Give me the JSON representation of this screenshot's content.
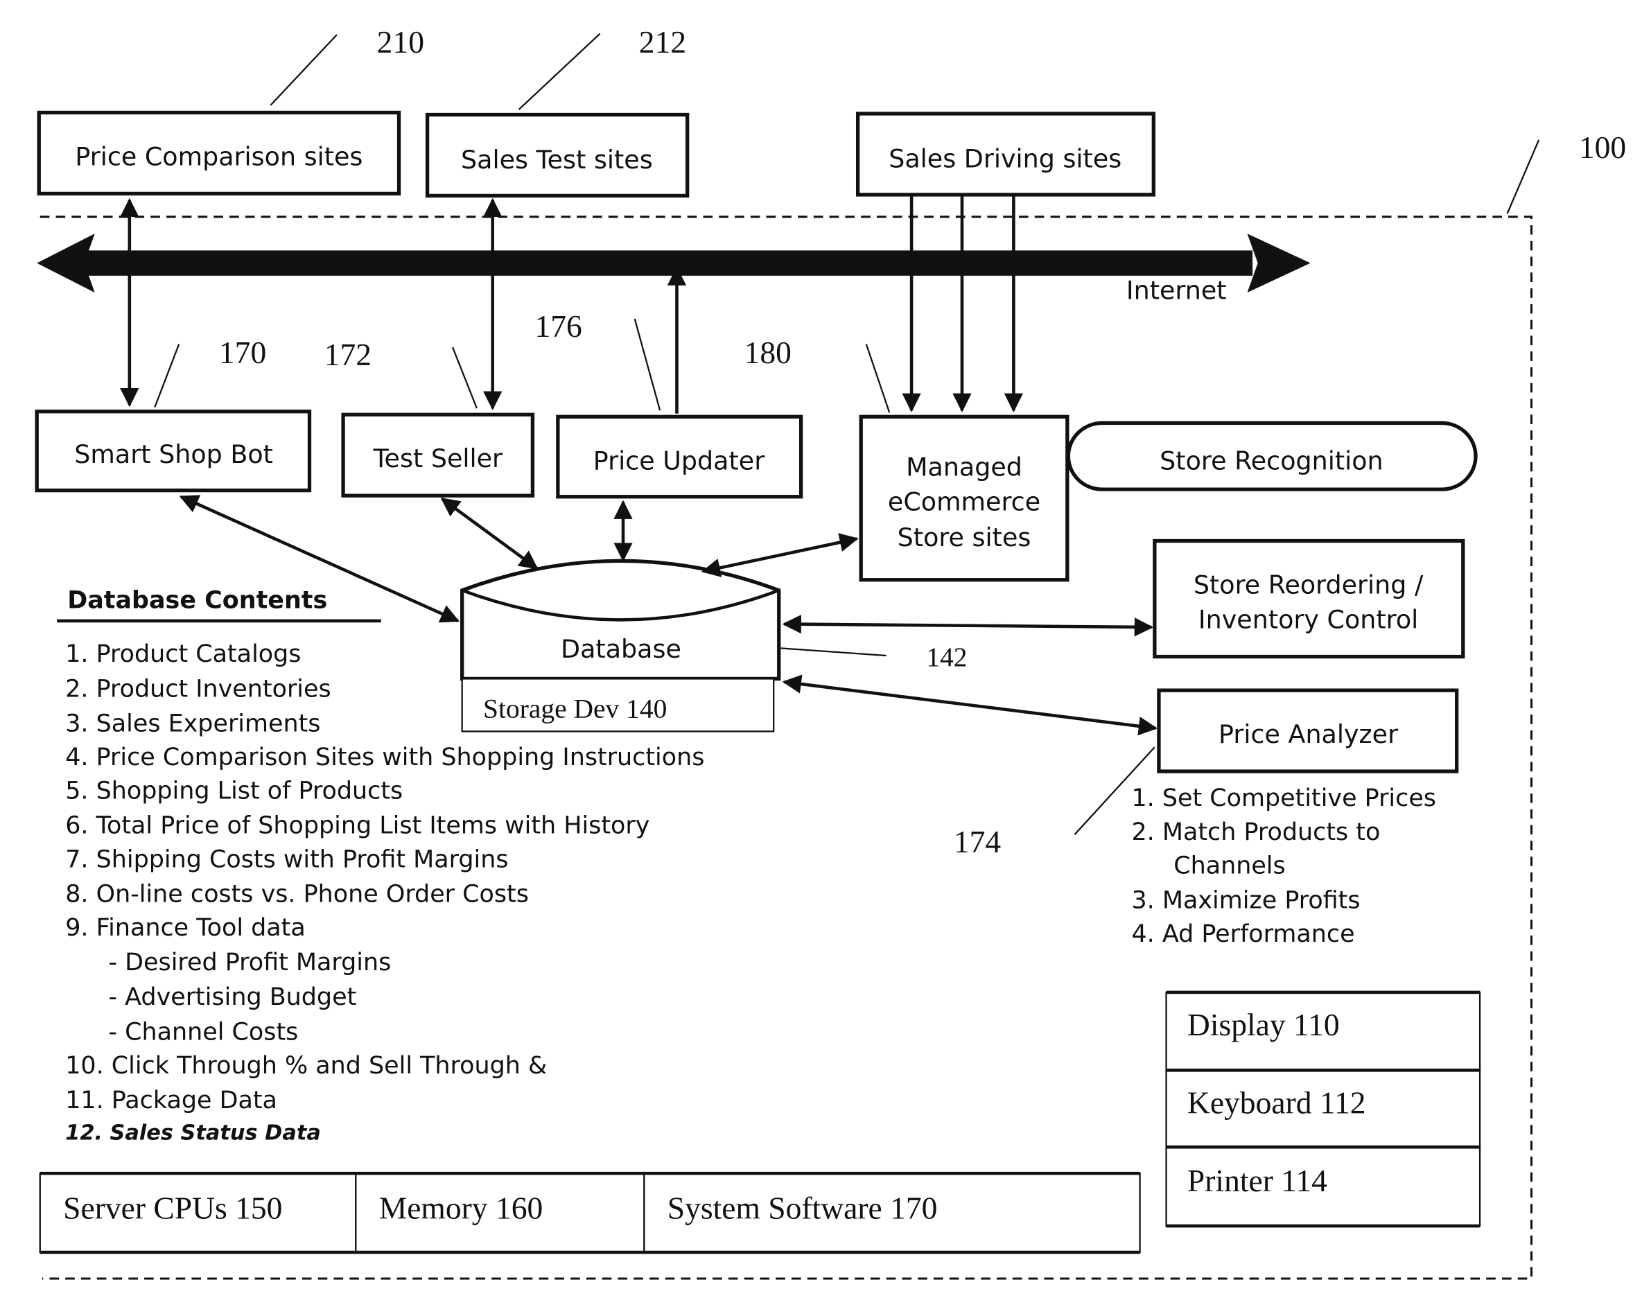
{
  "figure_ref": "100",
  "external_sites": [
    {
      "label": "Price Comparison sites",
      "ref": "210"
    },
    {
      "label": "Sales Test sites",
      "ref": "212"
    },
    {
      "label": "Sales Driving sites"
    }
  ],
  "internet_label": "Internet",
  "modules": {
    "smart_shop_bot": {
      "label": "Smart Shop Bot",
      "ref": "170"
    },
    "test_seller": {
      "label": "Test Seller",
      "ref": "172"
    },
    "price_updater": {
      "label": "Price Updater",
      "ref": "176"
    },
    "managed_store": {
      "lines": [
        "Managed",
        "eCommerce",
        "Store sites"
      ],
      "ref": "180"
    },
    "store_recognition": {
      "label": "Store Recognition"
    },
    "store_reordering": {
      "lines": [
        "Store Reordering /",
        "Inventory Control"
      ]
    },
    "price_analyzer": {
      "label": "Price Analyzer",
      "ref": "174"
    }
  },
  "database": {
    "label": "Database",
    "storage_label": "Storage Dev 140",
    "ref": "142"
  },
  "database_contents": {
    "title": "Database Contents",
    "items": [
      "1.  Product Catalogs",
      "2.  Product Inventories",
      "3.  Sales Experiments",
      "4.  Price Comparison Sites with Shopping Instructions",
      "5.  Shopping List of Products",
      "6.  Total Price of Shopping List Items with History",
      "7.  Shipping Costs with Profit Margins",
      "8.  On-line costs vs. Phone Order Costs",
      "9.  Finance Tool data",
      "- Desired Profit Margins",
      "- Advertising Budget",
      "- Channel Costs",
      "10. Click Through % and Sell Through &",
      "11. Package Data",
      "12.  Sales Status Data"
    ]
  },
  "price_analyzer_functions": [
    "1.  Set Competitive Prices",
    "2.  Match Products to",
    "Channels",
    "3.  Maximize Profits",
    "4.  Ad Performance"
  ],
  "hardware": {
    "bottom_row": [
      "Server CPUs 150",
      "Memory 160",
      "System Software 170"
    ],
    "io_devices": [
      "Display 110",
      "Keyboard 112",
      "Printer 114"
    ]
  }
}
